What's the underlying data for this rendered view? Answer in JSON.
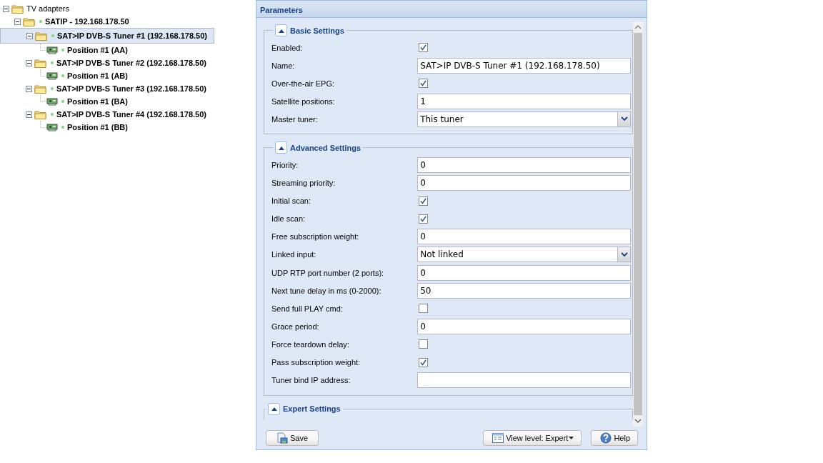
{
  "tree": [
    {
      "label": "TV adapters",
      "kind": "folder",
      "expanded": true,
      "selected": false,
      "children": [
        {
          "label": "SATIP - 192.168.178.50",
          "kind": "folder",
          "expanded": true,
          "selected": false,
          "children": [
            {
              "label": "SAT>IP DVB-S Tuner #1 (192.168.178.50)",
              "kind": "folder",
              "expanded": true,
              "selected": true,
              "children": [
                {
                  "label": "Position #1 (AA)",
                  "kind": "adapter",
                  "selected": false
                }
              ]
            },
            {
              "label": "SAT>IP DVB-S Tuner #2 (192.168.178.50)",
              "kind": "folder",
              "expanded": true,
              "selected": false,
              "children": [
                {
                  "label": "Position #1 (AB)",
                  "kind": "adapter",
                  "selected": false
                }
              ]
            },
            {
              "label": "SAT>IP DVB-S Tuner #3 (192.168.178.50)",
              "kind": "folder",
              "expanded": true,
              "selected": false,
              "children": [
                {
                  "label": "Position #1 (BA)",
                  "kind": "adapter",
                  "selected": false
                }
              ]
            },
            {
              "label": "SAT>IP DVB-S Tuner #4 (192.168.178.50)",
              "kind": "folder",
              "expanded": true,
              "selected": false,
              "children": [
                {
                  "label": "Position #1 (BB)",
                  "kind": "adapter",
                  "selected": false
                }
              ]
            }
          ]
        }
      ]
    }
  ],
  "panel": {
    "title": "Parameters",
    "sections": [
      {
        "title": "Basic Settings",
        "expanded": true,
        "fields": [
          {
            "label": "Enabled:",
            "kind": "checkbox",
            "checked": true
          },
          {
            "label": "Name:",
            "kind": "text",
            "value": "SAT>IP DVB-S Tuner #1 (192.168.178.50)"
          },
          {
            "label": "Over-the-air EPG:",
            "kind": "checkbox",
            "checked": true
          },
          {
            "label": "Satellite positions:",
            "kind": "text",
            "value": "1"
          },
          {
            "label": "Master tuner:",
            "kind": "select",
            "value": "This tuner"
          }
        ]
      },
      {
        "title": "Advanced Settings",
        "expanded": true,
        "fields": [
          {
            "label": "Priority:",
            "kind": "text",
            "value": "0"
          },
          {
            "label": "Streaming priority:",
            "kind": "text",
            "value": "0"
          },
          {
            "label": "Initial scan:",
            "kind": "checkbox",
            "checked": true
          },
          {
            "label": "Idle scan:",
            "kind": "checkbox",
            "checked": true
          },
          {
            "label": "Free subscription weight:",
            "kind": "text",
            "value": "0"
          },
          {
            "label": "Linked input:",
            "kind": "select",
            "value": "Not linked"
          },
          {
            "label": "UDP RTP port number (2 ports):",
            "kind": "text",
            "value": "0"
          },
          {
            "label": "Next tune delay in ms (0-2000):",
            "kind": "text",
            "value": "50"
          },
          {
            "label": "Send full PLAY cmd:",
            "kind": "checkbox",
            "checked": false
          },
          {
            "label": "Grace period:",
            "kind": "text",
            "value": "0"
          },
          {
            "label": "Force teardown delay:",
            "kind": "checkbox",
            "checked": false
          },
          {
            "label": "Pass subscription weight:",
            "kind": "checkbox",
            "checked": true
          },
          {
            "label": "Tuner bind IP address:",
            "kind": "text"
          }
        ]
      },
      {
        "title": "Expert Settings",
        "expanded": true
      }
    ],
    "buttons": [
      {
        "label": "Save",
        "kind": "save"
      },
      {
        "label": "View level: Expert",
        "kind": "menu"
      },
      {
        "label": "Help",
        "kind": "help"
      }
    ]
  }
}
